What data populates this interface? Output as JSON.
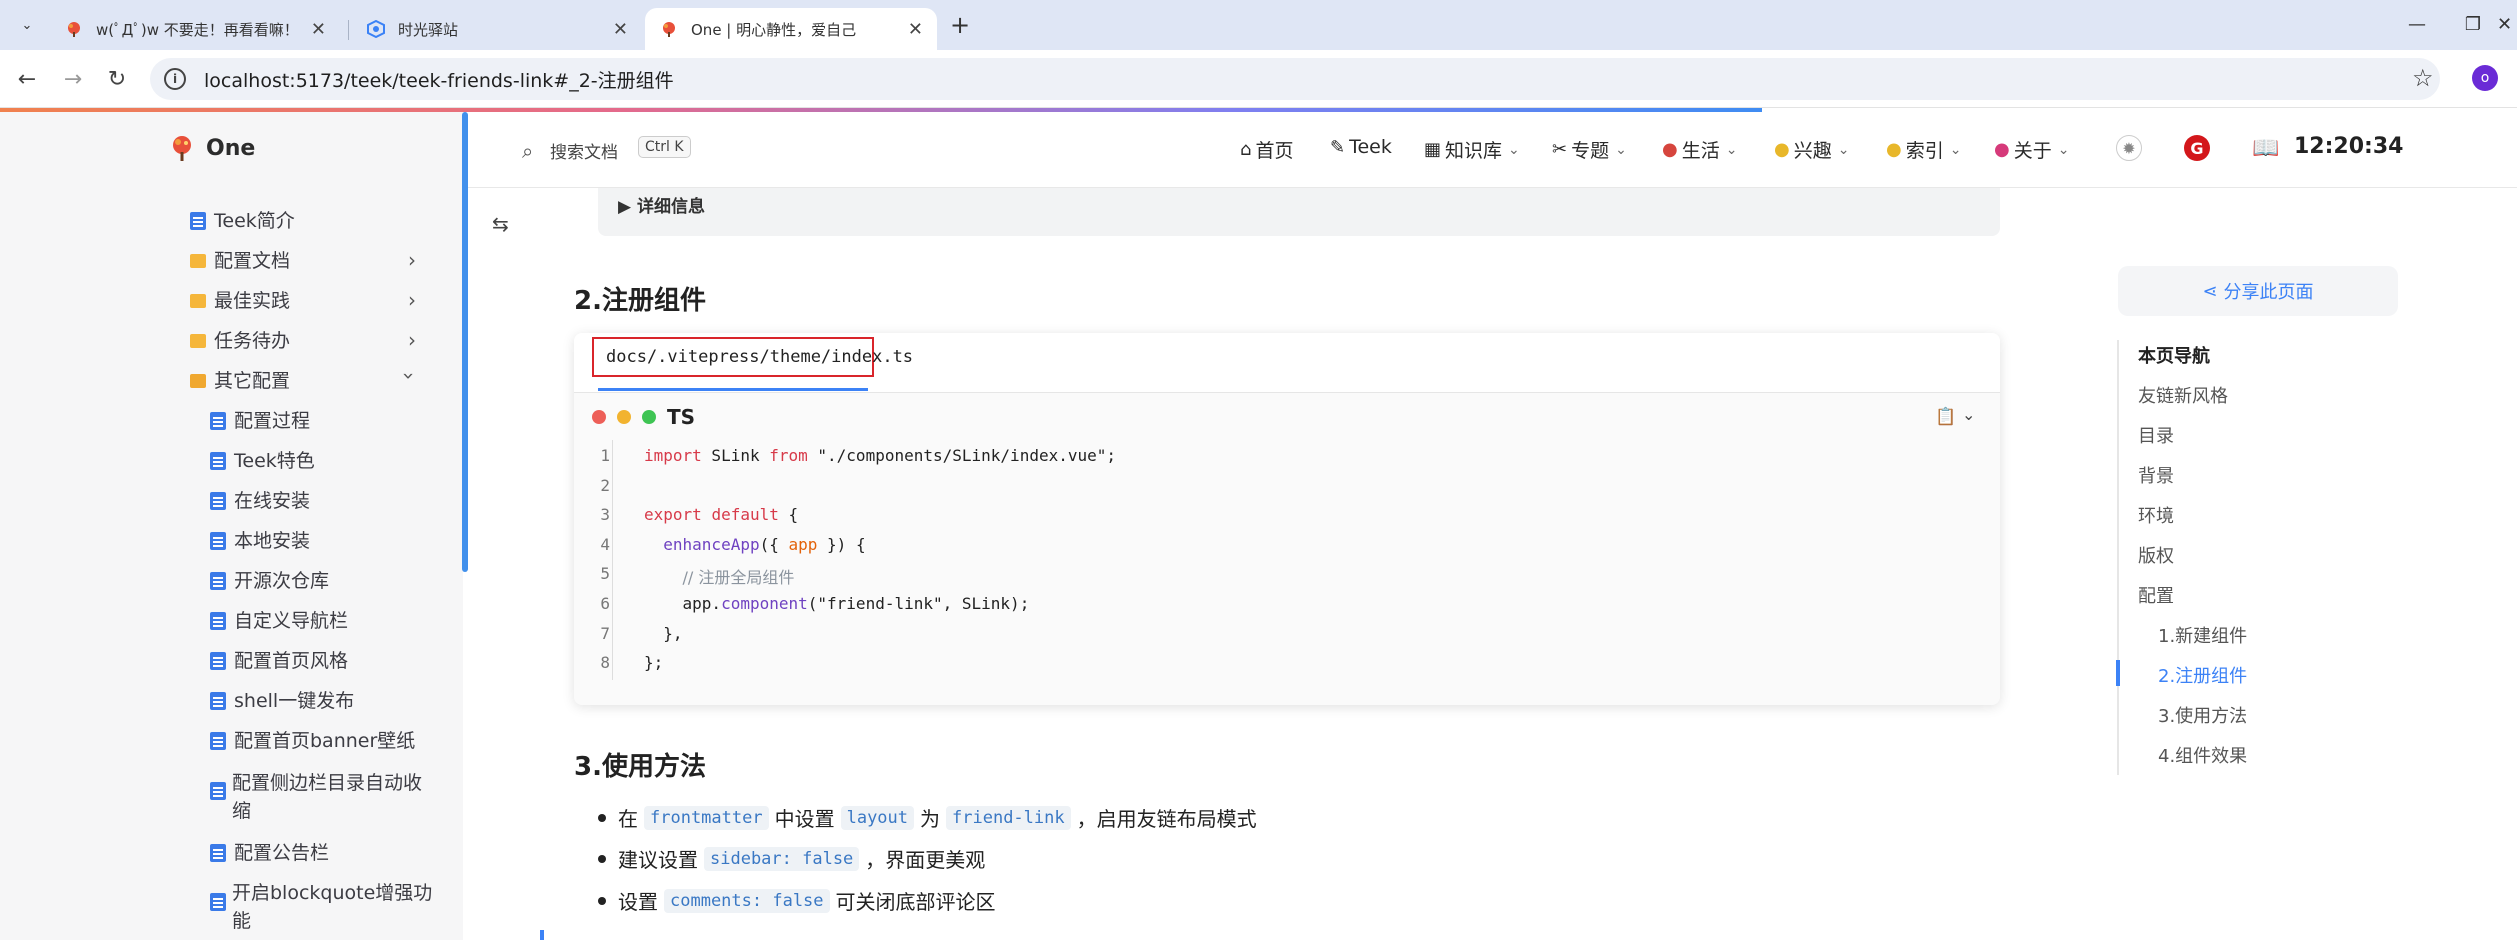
{
  "browser": {
    "tabs": [
      {
        "title": "w(ﾟДﾟ)w 不要走！再看看嘛！",
        "active": false
      },
      {
        "title": "时光驿站",
        "active": false
      },
      {
        "title": "One | 明心静性，爱自己",
        "active": true
      }
    ],
    "url": "localhost:5173/teek/teek-friends-link#_2-注册组件",
    "profile_initial": "o",
    "loading_progress_fraction": 0.7
  },
  "site": {
    "name": "One"
  },
  "sidebar": {
    "items": [
      {
        "label": "Teek简介",
        "type": "doc"
      },
      {
        "label": "配置文档",
        "type": "folder",
        "expanded": false
      },
      {
        "label": "最佳实践",
        "type": "folder",
        "expanded": false
      },
      {
        "label": "任务待办",
        "type": "folder",
        "expanded": false
      },
      {
        "label": "其它配置",
        "type": "folder-open",
        "expanded": true
      }
    ],
    "children": [
      "配置过程",
      "Teek特色",
      "在线安装",
      "本地安装",
      "开源次仓库",
      "自定义导航栏",
      "配置首页风格",
      "shell一键发布",
      "配置首页banner壁纸",
      "配置侧边栏目录自动收",
      "缩",
      "配置公告栏",
      "开启blockquote增强功",
      "能"
    ]
  },
  "navbar": {
    "search_label": "搜索文档",
    "search_shortcut": "Ctrl K",
    "items": [
      {
        "icon": "home-icon",
        "label": "首页",
        "dropdown": false
      },
      {
        "icon": "teek-icon",
        "label": "Teek",
        "dropdown": false
      },
      {
        "icon": "knowledge-icon",
        "label": "知识库",
        "dropdown": true
      },
      {
        "icon": "topic-icon",
        "label": "专题",
        "dropdown": true
      },
      {
        "icon": "life-icon",
        "label": "生活",
        "dropdown": true
      },
      {
        "icon": "hobby-icon",
        "label": "兴趣",
        "dropdown": true
      },
      {
        "icon": "index-icon",
        "label": "索引",
        "dropdown": true
      },
      {
        "icon": "about-icon",
        "label": "关于",
        "dropdown": true
      }
    ],
    "clock": "12:20:34",
    "gitee_letter": "G"
  },
  "content": {
    "details_label": "详细信息",
    "section2_title": "2.注册组件",
    "code": {
      "filename": "docs/.vitepress/theme/index.ts",
      "lang": "TS",
      "line_numbers": [
        "1",
        "2",
        "3",
        "4",
        "5",
        "6",
        "7",
        "8"
      ],
      "lines": [
        [
          {
            "t": "import",
            "c": "kw"
          },
          {
            "t": " SLink "
          },
          {
            "t": "from",
            "c": "kw"
          },
          {
            "t": " \"./components/SLink/index.vue\";"
          }
        ],
        [],
        [
          {
            "t": "export",
            "c": "kw"
          },
          {
            "t": " "
          },
          {
            "t": "default",
            "c": "kw"
          },
          {
            "t": " {"
          }
        ],
        [
          {
            "t": "  "
          },
          {
            "t": "enhanceApp",
            "c": "fn"
          },
          {
            "t": "({ "
          },
          {
            "t": "app",
            "c": "param"
          },
          {
            "t": " }) {"
          }
        ],
        [
          {
            "t": "    "
          },
          {
            "t": "// 注册全局组件",
            "c": "comment"
          }
        ],
        [
          {
            "t": "    app."
          },
          {
            "t": "component",
            "c": "fn"
          },
          {
            "t": "(\"friend-link\", SLink);"
          }
        ],
        [
          {
            "t": "  },"
          }
        ],
        [
          {
            "t": "};"
          }
        ]
      ]
    },
    "section3_title": "3.使用方法",
    "bullets": [
      [
        {
          "t": "在"
        },
        {
          "code": "frontmatter"
        },
        {
          "t": "中设置"
        },
        {
          "code": "layout"
        },
        {
          "t": "为"
        },
        {
          "code": "friend-link"
        },
        {
          "t": "，启用友链布局模式"
        }
      ],
      [
        {
          "t": "建议设置"
        },
        {
          "code": "sidebar: false"
        },
        {
          "t": "，界面更美观"
        }
      ],
      [
        {
          "t": "设置"
        },
        {
          "code": "comments: false"
        },
        {
          "t": "可关闭底部评论区"
        }
      ]
    ]
  },
  "aside": {
    "share_label": "分享此页面",
    "toc_title": "本页导航",
    "toc": [
      {
        "label": "友链新风格",
        "level": 1
      },
      {
        "label": "目录",
        "level": 1
      },
      {
        "label": "背景",
        "level": 1
      },
      {
        "label": "环境",
        "level": 1
      },
      {
        "label": "版权",
        "level": 1
      },
      {
        "label": "配置",
        "level": 1
      },
      {
        "label": "1.新建组件",
        "level": 2
      },
      {
        "label": "2.注册组件",
        "level": 2,
        "active": true
      },
      {
        "label": "3.使用方法",
        "level": 2
      },
      {
        "label": "4.组件效果",
        "level": 2
      }
    ]
  },
  "colors": {
    "accent": "#3c82f6",
    "keyword": "#d73a49",
    "function": "#6f42c1",
    "param": "#e36209",
    "comment": "#8b949e",
    "string": "#032f62"
  }
}
